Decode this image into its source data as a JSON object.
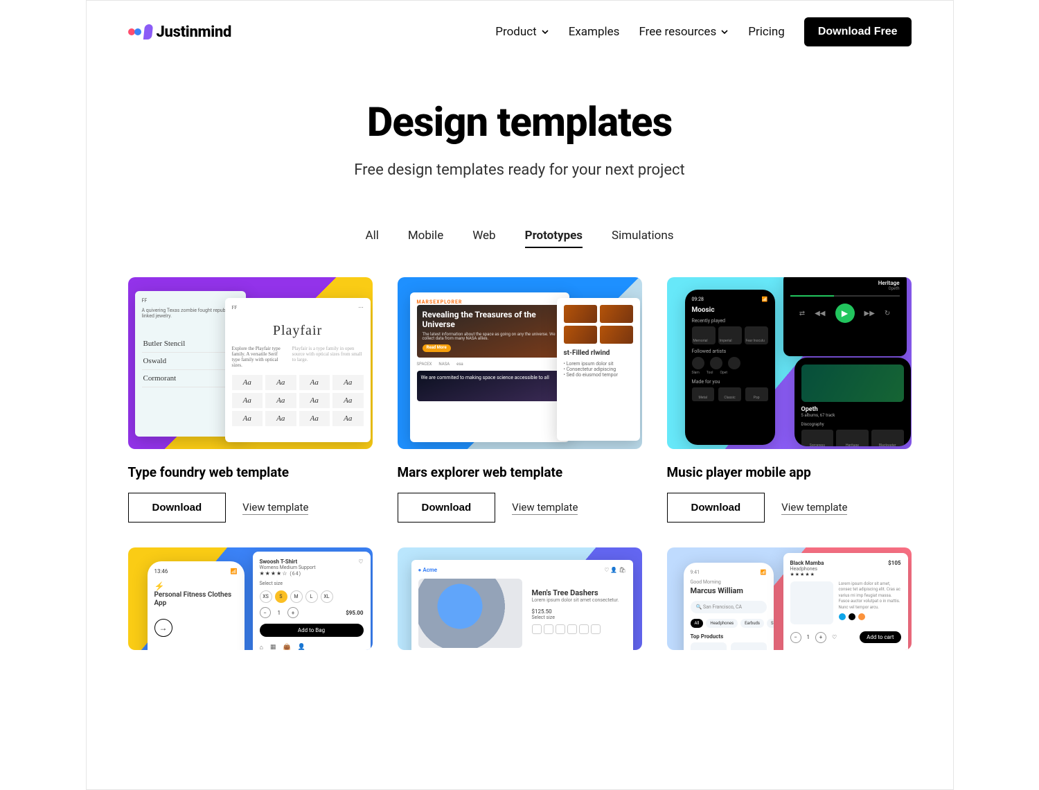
{
  "brand": "Justinmind",
  "nav": {
    "items": [
      {
        "label": "Product",
        "hasDropdown": true
      },
      {
        "label": "Examples",
        "hasDropdown": false
      },
      {
        "label": "Free resources",
        "hasDropdown": true
      },
      {
        "label": "Pricing",
        "hasDropdown": false
      }
    ],
    "cta": "Download Free"
  },
  "hero": {
    "title": "Design templates",
    "subtitle": "Free design templates ready for your next project"
  },
  "tabs": [
    {
      "label": "All",
      "active": false
    },
    {
      "label": "Mobile",
      "active": false
    },
    {
      "label": "Web",
      "active": false
    },
    {
      "label": "Prototypes",
      "active": true
    },
    {
      "label": "Simulations",
      "active": false
    }
  ],
  "actions": {
    "download": "Download",
    "view": "View template"
  },
  "cards": [
    {
      "title": "Type foundry web template",
      "thumb": {
        "playfair": "Playfair",
        "playfair_desc": "Explore the Playfair type family. A versatile Serif type family with optical sizes.",
        "aa": "Aa",
        "fonts": [
          "Butler Stencil",
          "Oswald",
          "Cormorant"
        ],
        "tagline": "A quivering Texas zombie fought republic linked jewelry."
      }
    },
    {
      "title": "Mars explorer web template",
      "thumb": {
        "logo": "MARSEXPLORER",
        "headline": "Revealing the Treasures of the Universe",
        "partners": [
          "SPACEX",
          "NASA",
          "esa"
        ],
        "banner": "We are commited to making space science accessible to all",
        "side": "st-Filled rlwind"
      }
    },
    {
      "title": "Music player mobile app",
      "thumb": {
        "time": "09:28",
        "app": "Moosic",
        "recently": "Recently played",
        "recent_items": [
          "Memorial",
          "Imperial",
          "Fear Inoculu"
        ],
        "followed": "Followed artists",
        "artists": [
          "Slam",
          "Tool",
          "Opet"
        ],
        "madefor": "Made for you",
        "chips": [
          "Metal",
          "Classic",
          "Pop"
        ],
        "track": {
          "title": "Heritage",
          "artist": "Opeth"
        },
        "artist_page": {
          "name": "Opeth",
          "meta": "5 albums, 67 track",
          "disc": "Discography",
          "albums": [
            "Sorceress",
            "Heritage",
            "Blackwater"
          ]
        }
      }
    },
    {
      "title": "",
      "thumb": {
        "time": "13:46",
        "headline": "Personal Fitness Clothes App",
        "product": "Swoosh T-Shirt",
        "sub": "Womens Medium Support",
        "select_size": "Select size",
        "sizes": [
          "XS",
          "S",
          "M",
          "L",
          "XL"
        ],
        "qty": "1",
        "price": "$95.00",
        "add": "Add to Bag"
      }
    },
    {
      "title": "",
      "thumb": {
        "brand": "Acme",
        "product": "Men's Tree Dashers",
        "price": "$125.50",
        "select_size": "Select size"
      }
    },
    {
      "title": "",
      "thumb": {
        "time": "9:41",
        "greeting": "Good Morning",
        "user": "Marcus William",
        "location": "San Francisco, CA",
        "pills": [
          "All",
          "Headphones",
          "Earbuds",
          "S"
        ],
        "top": "Top Products",
        "bm_name": "Black Mamba",
        "bm_cat": "Headphones",
        "bm_price": "$105",
        "bm_blurb": "Lorem ipsum dolor sit amet, consec tet adipiscing elit. Cras ac varius mi imp feugiat massa. Fusce auctor volutpat o in mattis. Nunc vel tempor arcu.",
        "bm_qty": "1",
        "bm_add": "Add to cart"
      }
    }
  ]
}
